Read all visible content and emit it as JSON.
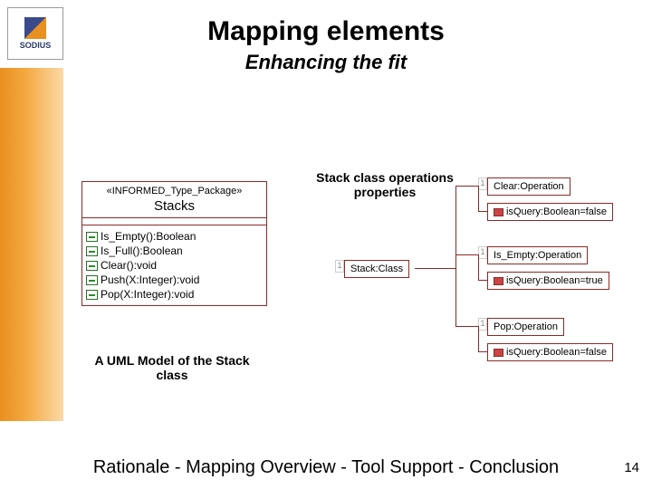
{
  "logo": {
    "text": "SODIUS"
  },
  "title": "Mapping elements",
  "subtitle": "Enhancing the fit",
  "uml": {
    "stereotype": "«INFORMED_Type_Package»",
    "name": "Stacks",
    "operations": [
      "Is_Empty():Boolean",
      "Is_Full():Boolean",
      "Clear():void",
      "Push(X:Integer):void",
      "Pop(X:Integer):void"
    ],
    "caption": "A UML Model of the Stack class"
  },
  "opsLabel": "Stack class operations properties",
  "hub": {
    "idx": "1",
    "label": "Stack:Class"
  },
  "props": [
    {
      "idx": "1",
      "label": "Clear:Operation",
      "sub": {
        "idx": "",
        "label": "isQuery:Boolean=false"
      }
    },
    {
      "idx": "1",
      "label": "Is_Empty:Operation",
      "sub": {
        "idx": "",
        "label": "isQuery:Boolean=true"
      }
    },
    {
      "idx": "1",
      "label": "Pop:Operation",
      "sub": {
        "idx": "",
        "label": "isQuery:Boolean=false"
      }
    }
  ],
  "footer": "Rationale - Mapping Overview - Tool Support - Conclusion",
  "page": "14"
}
